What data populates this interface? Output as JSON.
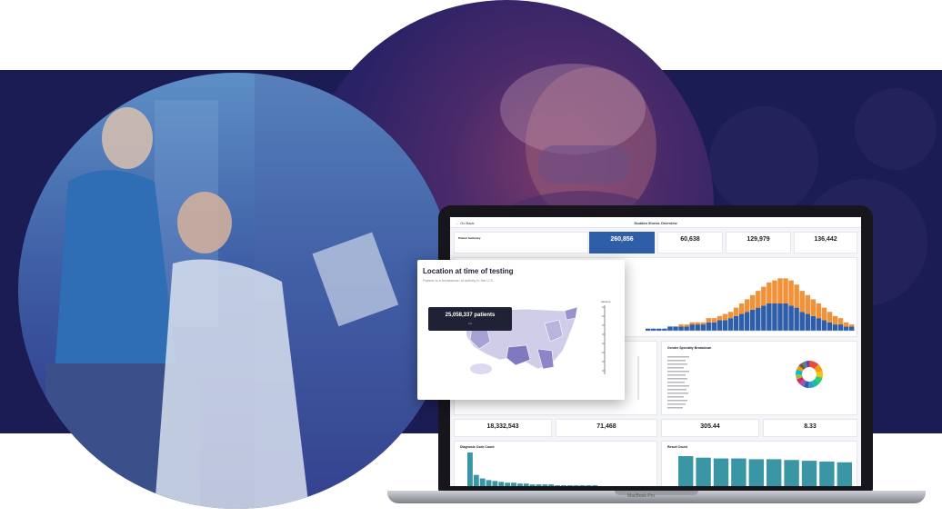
{
  "dashboard": {
    "back": "← Go Back",
    "title": "Sudden Illness Overview",
    "stats_top": [
      {
        "value": "260,856",
        "label": ""
      },
      {
        "value": "60,638",
        "label": ""
      },
      {
        "value": "129,979",
        "label": ""
      },
      {
        "value": "136,442",
        "label": ""
      }
    ],
    "summary_title": "Patient Summary",
    "specialty_title": "Gender Specialty Breakdown",
    "stats_bottom": [
      {
        "value": "18,332,543",
        "label": ""
      },
      {
        "value": "71,468",
        "label": ""
      },
      {
        "value": "305.44",
        "label": ""
      },
      {
        "value": "8.33",
        "label": ""
      }
    ],
    "diagnosis_title": "Diagnosis Code Count",
    "provider_title": "Result Count",
    "series_colors": {
      "primary": "#2e5ea8",
      "secondary": "#f0923a",
      "teal": "#3a96a4"
    }
  },
  "overlay": {
    "title": "Location at time of testing",
    "subtitle": "Patient is a breakdown of activity in the U.S.",
    "tooltip_value": "25,058,337 patients",
    "tooltip_sub": "CA",
    "legend_label": "patients"
  },
  "laptop": {
    "brand": "MacBook Pro"
  },
  "chart_data": [
    {
      "type": "bar",
      "stacked": true,
      "title": "",
      "series": [
        {
          "values": [
            1,
            1,
            1,
            1,
            2,
            2,
            2,
            2,
            3,
            3,
            3,
            4,
            4,
            5,
            5,
            6,
            7,
            8,
            9,
            10,
            11,
            12,
            13,
            13,
            13,
            13,
            12,
            11,
            9,
            8,
            7,
            6,
            5,
            4,
            3,
            3,
            2,
            2
          ]
        },
        {
          "values": [
            0,
            0,
            0,
            0,
            0,
            0,
            1,
            1,
            1,
            1,
            1,
            2,
            2,
            2,
            3,
            3,
            4,
            5,
            6,
            7,
            8,
            9,
            10,
            11,
            12,
            12,
            12,
            11,
            10,
            9,
            8,
            7,
            6,
            5,
            4,
            3,
            2,
            1
          ]
        }
      ]
    },
    {
      "type": "bar",
      "title": "",
      "values": [
        40,
        14,
        10,
        8,
        7,
        6,
        5,
        5,
        4,
        4,
        3,
        3,
        3,
        3,
        2,
        2,
        2,
        2,
        2,
        2,
        2,
        1,
        1,
        1,
        1,
        1,
        1,
        1,
        1,
        1
      ]
    },
    {
      "type": "bar",
      "title": "",
      "values": [
        40,
        38,
        37,
        37,
        36,
        36,
        35,
        34,
        33,
        32
      ]
    },
    {
      "type": "pie",
      "values": [
        12,
        9,
        8,
        8,
        7,
        7,
        6,
        6,
        6,
        6,
        6,
        5,
        5,
        5,
        4
      ]
    }
  ]
}
